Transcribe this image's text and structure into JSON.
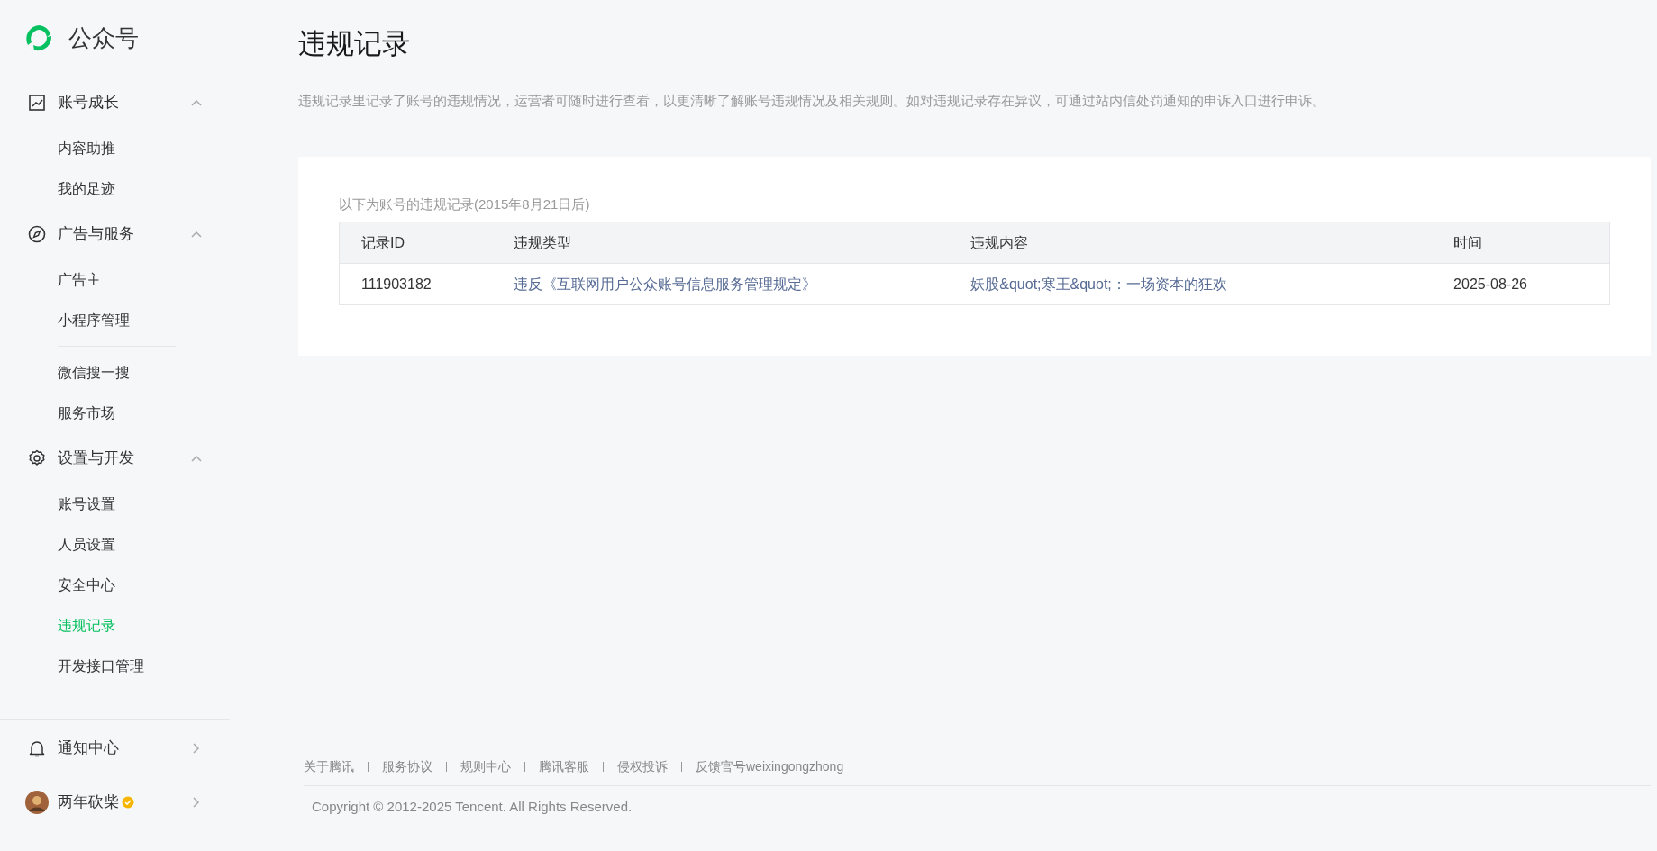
{
  "brand": {
    "title": "公众号"
  },
  "sidebar": {
    "sections": [
      {
        "label": "账号成长",
        "expanded": true,
        "groups": [
          [
            {
              "label": "内容助推",
              "selected": false
            },
            {
              "label": "我的足迹",
              "selected": false
            }
          ]
        ]
      },
      {
        "label": "广告与服务",
        "expanded": true,
        "groups": [
          [
            {
              "label": "广告主",
              "selected": false
            },
            {
              "label": "小程序管理",
              "selected": false
            }
          ],
          [
            {
              "label": "微信搜一搜",
              "selected": false
            },
            {
              "label": "服务市场",
              "selected": false
            }
          ]
        ]
      },
      {
        "label": "设置与开发",
        "expanded": true,
        "groups": [
          [
            {
              "label": "账号设置",
              "selected": false
            },
            {
              "label": "人员设置",
              "selected": false
            },
            {
              "label": "安全中心",
              "selected": false
            },
            {
              "label": "违规记录",
              "selected": true
            },
            {
              "label": "开发接口管理",
              "selected": false
            }
          ]
        ]
      }
    ],
    "bottom": [
      {
        "label": "通知中心",
        "expanded": false
      }
    ],
    "user": {
      "name": "两年砍柴",
      "verified": true
    }
  },
  "page": {
    "title": "违规记录",
    "description": "违规记录里记录了账号的违规情况，运营者可随时进行查看，以更清晰了解账号违规情况及相关规则。如对违规记录存在异议，可通过站内信处罚通知的申诉入口进行申诉。"
  },
  "records": {
    "caption": "以下为账号的违规记录(2015年8月21日后)",
    "columns": [
      "记录ID",
      "违规类型",
      "违规内容",
      "时间"
    ],
    "rows": [
      {
        "id": "111903182",
        "type": "违反《互联网用户公众账号信息服务管理规定》",
        "content": "妖股&quot;寒王&quot;：一场资本的狂欢",
        "time": "2025-08-26"
      }
    ]
  },
  "footer": {
    "links": [
      "关于腾讯",
      "服务协议",
      "规则中心",
      "腾讯客服",
      "侵权投诉",
      "反馈官号weixingongzhong"
    ],
    "copyright": "Copyright © 2012-2025 Tencent. All Rights Reserved."
  }
}
